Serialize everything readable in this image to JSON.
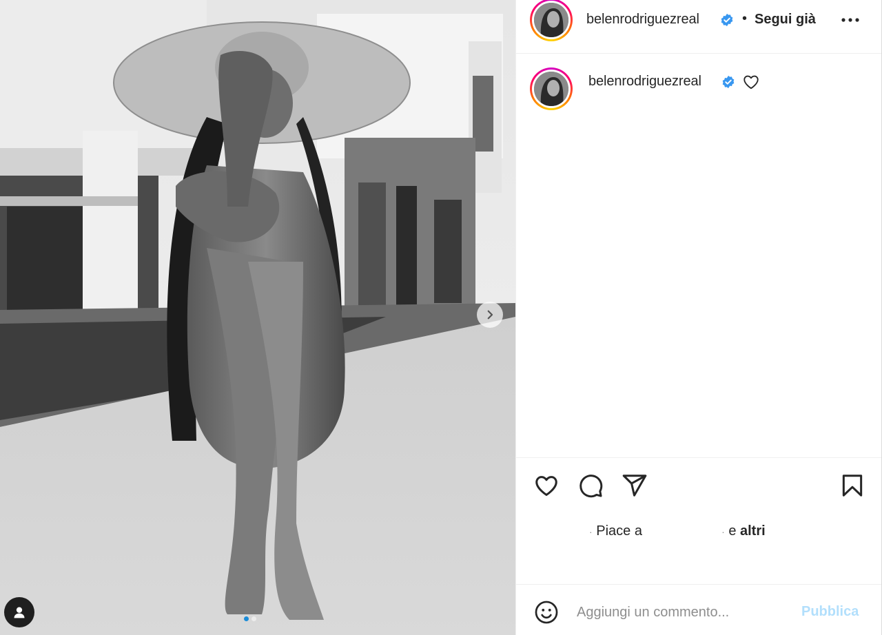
{
  "post": {
    "author": "belenrodriguezreal",
    "follow_label": "Segui già",
    "separator": "•",
    "caption_author": "belenrodriguezreal",
    "image_alt": "Black and white photo of a woman in a wide straw hat sitting barefoot in front of a modern house",
    "carousel": {
      "count": 2,
      "active": 0
    }
  },
  "likes": {
    "dot": "·",
    "prefix": "Piace a",
    "joiner": "e",
    "others": "altri"
  },
  "comment": {
    "placeholder": "Aggiungi un commento...",
    "publish_label": "Pubblica"
  },
  "icons": {
    "header_more": "more-horizontal-icon",
    "verified": "verified-badge-icon",
    "like": "heart-icon",
    "comment": "comment-icon",
    "share": "paper-plane-icon",
    "save": "bookmark-icon",
    "emoji": "smiley-icon",
    "next": "chevron-right-icon",
    "tags": "user-tag-icon"
  },
  "colors": {
    "verified": "#3897f0",
    "publish_disabled": "#b2dffc",
    "text": "#262626",
    "placeholder": "#8e8e8e",
    "divider": "#efefef"
  }
}
